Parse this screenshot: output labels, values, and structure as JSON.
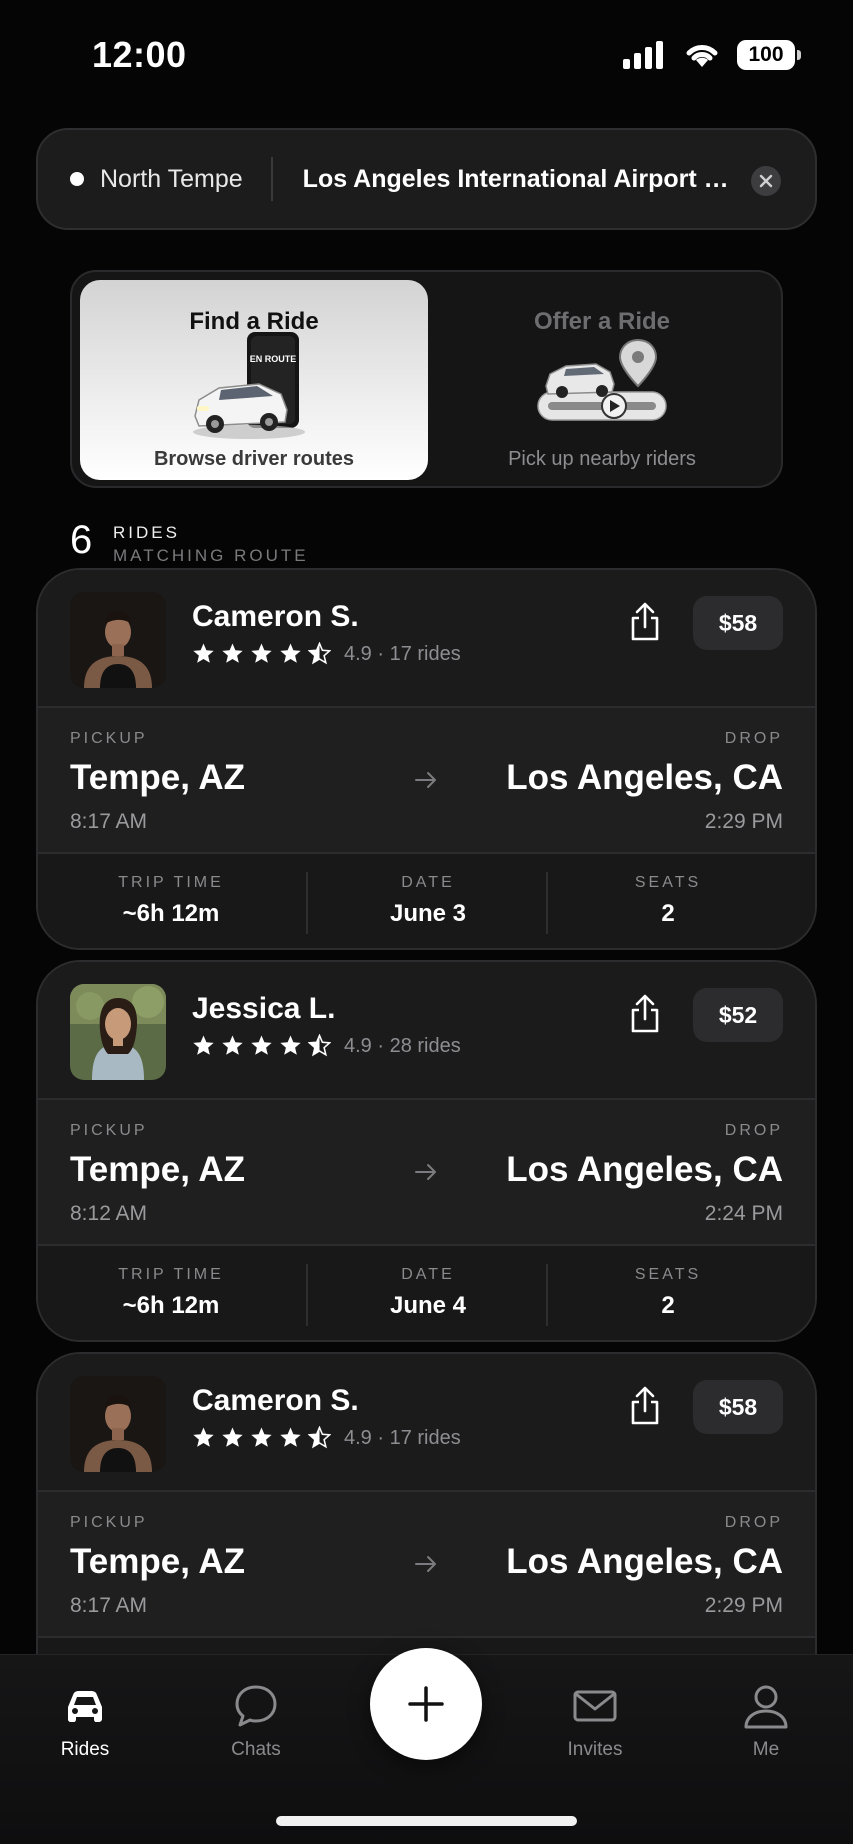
{
  "status_bar": {
    "time": "12:00",
    "battery": "100"
  },
  "route": {
    "origin": "North Tempe",
    "destination": "Los Angeles International Airport (LAX)"
  },
  "mode_toggle": {
    "find": {
      "title": "Find a Ride",
      "subtitle": "Browse driver routes",
      "sign_text": "EN ROUTE",
      "selected": true
    },
    "offer": {
      "title": "Offer a Ride",
      "subtitle": "Pick up nearby riders",
      "selected": false
    }
  },
  "results": {
    "count": "6",
    "label": "RIDES",
    "sublabel": "MATCHING ROUTE"
  },
  "rides": [
    {
      "driver": "Cameron S.",
      "stars": 4.5,
      "rating": "4.9 · 17 rides",
      "price": "$58",
      "pickup_label": "PICKUP",
      "pickup_city": "Tempe, AZ",
      "pickup_time": "8:17 AM",
      "drop_label": "DROP",
      "drop_city": "Los Angeles, CA",
      "drop_time": "2:29 PM",
      "trip_time_label": "TRIP TIME",
      "trip_time": "~6h 12m",
      "date_label": "DATE",
      "date": "June 3",
      "seats_label": "SEATS",
      "seats": "2"
    },
    {
      "driver": "Jessica L.",
      "stars": 4.5,
      "rating": "4.9 · 28 rides",
      "price": "$52",
      "pickup_label": "PICKUP",
      "pickup_city": "Tempe, AZ",
      "pickup_time": "8:12 AM",
      "drop_label": "DROP",
      "drop_city": "Los Angeles, CA",
      "drop_time": "2:24 PM",
      "trip_time_label": "TRIP TIME",
      "trip_time": "~6h 12m",
      "date_label": "DATE",
      "date": "June 4",
      "seats_label": "SEATS",
      "seats": "2"
    },
    {
      "driver": "Cameron S.",
      "stars": 4.5,
      "rating": "4.9 · 17 rides",
      "price": "$58",
      "pickup_label": "PICKUP",
      "pickup_city": "Tempe, AZ",
      "pickup_time": "8:17 AM",
      "drop_label": "DROP",
      "drop_city": "Los Angeles, CA",
      "drop_time": "2:29 PM",
      "trip_time_label": "TRIP TIME",
      "trip_time": "",
      "date_label": "DATE",
      "date": "",
      "seats_label": "SEATS",
      "seats": ""
    }
  ],
  "tab_bar": {
    "items": [
      {
        "label": "Rides",
        "icon": "car-icon",
        "active": true
      },
      {
        "label": "Chats",
        "icon": "chat-bubble-icon",
        "active": false
      },
      {
        "label": "Invites",
        "icon": "envelope-icon",
        "active": false
      },
      {
        "label": "Me",
        "icon": "person-icon",
        "active": false
      }
    ],
    "fab_icon": "plus-icon"
  }
}
